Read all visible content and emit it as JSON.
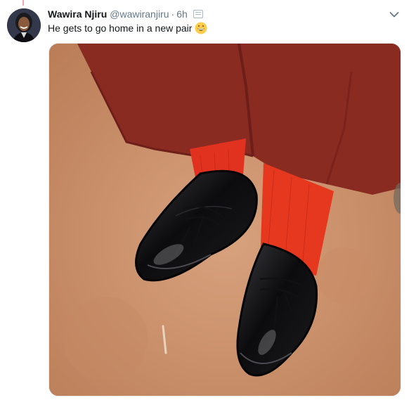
{
  "tweet": {
    "display_name": "Wawira Njiru",
    "handle": "@wawiranjiru",
    "separator": "·",
    "time": "6h",
    "text": "He gets to go home in a new pair",
    "emoji": "grinning-face-with-smiling-eyes-emoji"
  },
  "icons": {
    "more": "chevron-down-icon",
    "translate": "translate-icon"
  },
  "colors": {
    "name": "#14171a",
    "secondary": "#657786",
    "thread_line": "#f4a6b2",
    "media_border": "#e6ecf0"
  },
  "media": {
    "subject": "photo-black-school-shoes-red-socks"
  }
}
